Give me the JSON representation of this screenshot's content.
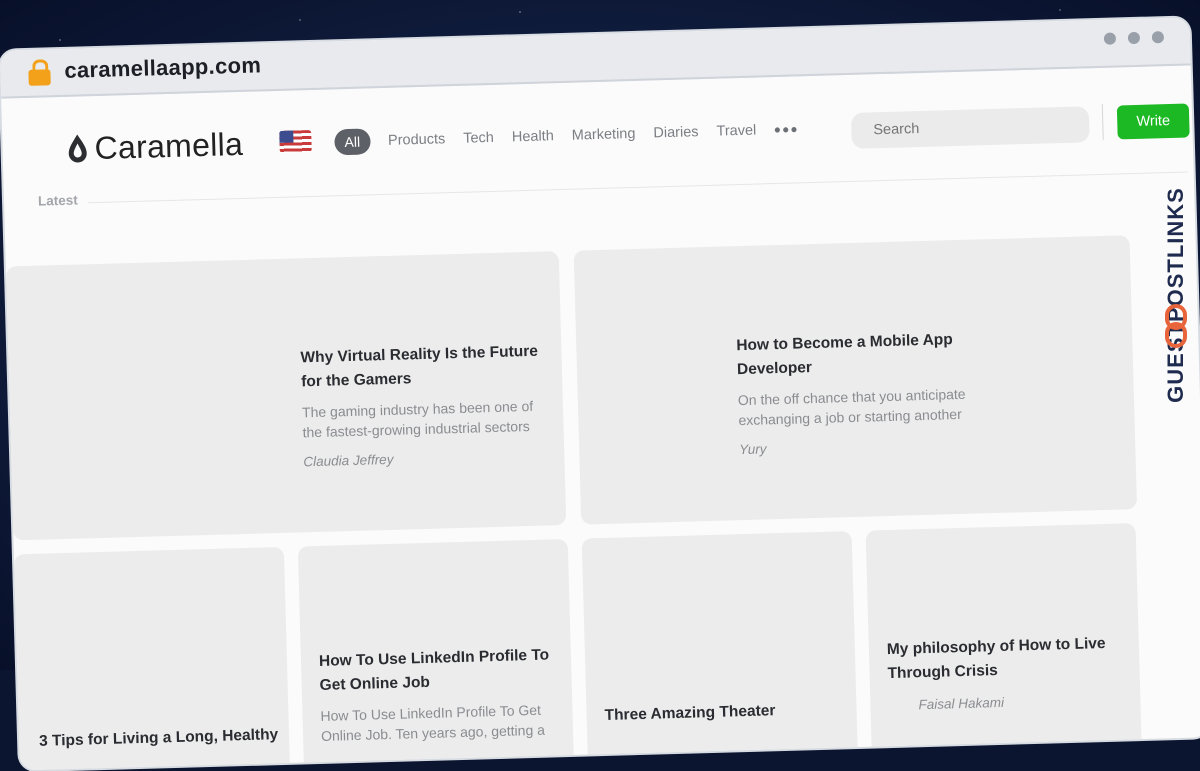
{
  "browser": {
    "url": "caramellaapp.com"
  },
  "watermark": "GUESTPOSTLINKS",
  "site": {
    "logo_text": "Caramella",
    "nav": [
      "All",
      "Products",
      "Tech",
      "Health",
      "Marketing",
      "Diaries",
      "Travel"
    ],
    "more_label": "•••",
    "search_placeholder": "Search",
    "write_label": "Write",
    "section_label": "Latest"
  },
  "featured": [
    {
      "title": "Why Virtual Reality Is the Future for the Gamers",
      "excerpt": "The gaming industry has been one of the fastest-growing industrial sectors",
      "author": "Claudia Jeffrey"
    },
    {
      "title": "How to Become a Mobile App Developer",
      "excerpt": "On the off chance that you anticipate exchanging a job or starting another",
      "author": "Yury"
    }
  ],
  "posts": [
    {
      "title": "3 Tips for Living a Long, Healthy"
    },
    {
      "title": "How To Use LinkedIn Profile To Get Online Job",
      "excerpt": "How To Use LinkedIn Profile To Get Online Job. Ten years ago, getting a"
    },
    {
      "title": "Three Amazing Theater"
    },
    {
      "title": "My philosophy of How to Live Through Crisis",
      "author": "Faisal Hakami"
    }
  ],
  "colors": {
    "accent": "#1db924",
    "watermark": "#1e2b4e",
    "watermark_icon": "#e8643a"
  }
}
